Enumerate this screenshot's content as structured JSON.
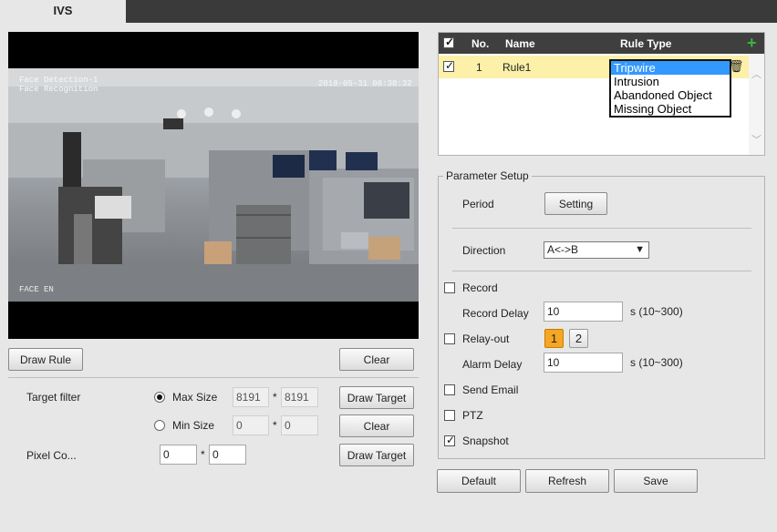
{
  "header": {
    "tab_label": "IVS"
  },
  "video": {
    "osd_top_left_1": "Face Detection-1",
    "osd_top_left_2": "Face Recognition",
    "osd_timestamp": "2018-05-31 08:30:32",
    "osd_bottom_left": "FACE EN"
  },
  "left": {
    "draw_rule": "Draw Rule",
    "clear_rule": "Clear",
    "target_filter_label": "Target filter",
    "max_size_label": "Max Size",
    "max_w": "8191",
    "max_h": "8191",
    "min_size_label": "Min Size",
    "min_w": "0",
    "min_h": "0",
    "times": "*",
    "draw_target": "Draw Target",
    "clear_target": "Clear",
    "pixel_label": "Pixel Co...",
    "pixel_w": "0",
    "pixel_h": "0",
    "draw_target_2": "Draw Target"
  },
  "rules": {
    "headers": {
      "no": "No.",
      "name": "Name",
      "type": "Rule Type"
    },
    "row": {
      "no": "1",
      "name": "Rule1"
    },
    "rule_type_options": [
      "Tripwire",
      "Intrusion",
      "Abandoned Object",
      "Missing Object"
    ],
    "selected_option": "Tripwire"
  },
  "params": {
    "legend": "Parameter Setup",
    "period_label": "Period",
    "setting_button": "Setting",
    "direction_label": "Direction",
    "direction_value": "A<->B",
    "record_label": "Record",
    "record_delay_label": "Record Delay",
    "record_delay_value": "10",
    "record_delay_unit": "s (10~300)",
    "relay_label": "Relay-out",
    "relay_1": "1",
    "relay_2": "2",
    "alarm_delay_label": "Alarm Delay",
    "alarm_delay_value": "10",
    "alarm_delay_unit": "s (10~300)",
    "email_label": "Send Email",
    "ptz_label": "PTZ",
    "snapshot_label": "Snapshot"
  },
  "footer": {
    "default": "Default",
    "refresh": "Refresh",
    "save": "Save"
  },
  "colors": {
    "accent_selected_row": "#fdf0a8",
    "dropdown_highlight": "#3399ff",
    "relay_active": "#f5a623",
    "add_icon": "#2aa52a"
  }
}
